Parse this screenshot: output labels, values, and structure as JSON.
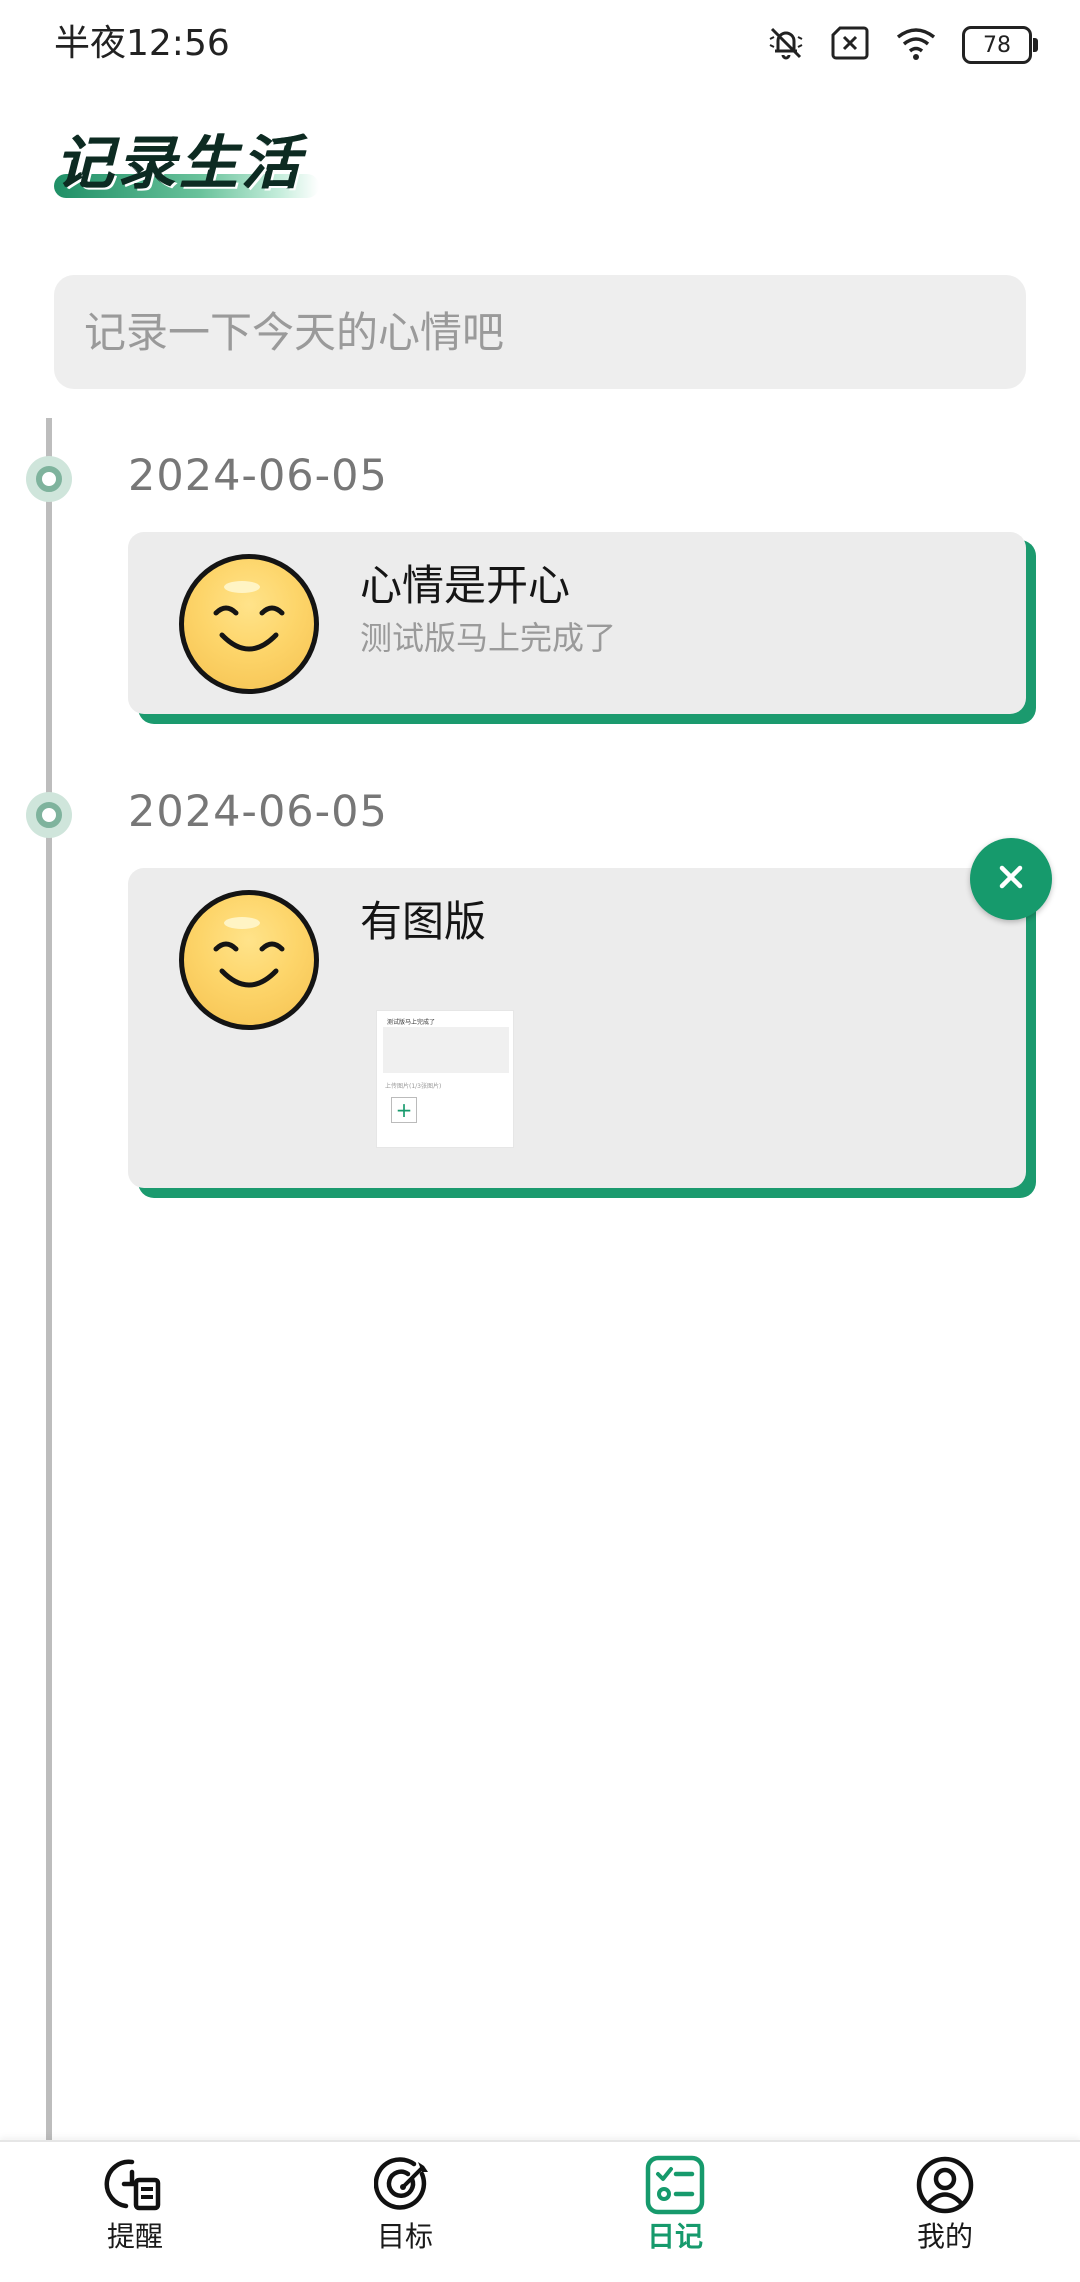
{
  "status_bar": {
    "time": "半夜12:56",
    "battery": "78",
    "icons": [
      "mute-bell-icon",
      "sim-x-icon",
      "wifi-icon",
      "battery-icon"
    ]
  },
  "header": {
    "title": "记录生活"
  },
  "mood_input": {
    "placeholder": "记录一下今天的心情吧",
    "value": ""
  },
  "entries": [
    {
      "date": "2024-06-05",
      "title": "心情是开心",
      "subtitle": "测试版马上完成了",
      "emoji": "smile-face-icon"
    },
    {
      "date": "2024-06-05",
      "title": "有图版",
      "emoji": "smile-face-icon",
      "delete_icon": "close-icon",
      "thumbnail": {
        "line1": "测试版马上完成了",
        "line2": "上传图片(1/3张图片)",
        "button": "+"
      }
    }
  ],
  "bottom_nav": [
    {
      "label": "提醒",
      "icon": "reminder-icon",
      "active": false
    },
    {
      "label": "目标",
      "icon": "target-icon",
      "active": false
    },
    {
      "label": "日记",
      "icon": "diary-icon",
      "active": true
    },
    {
      "label": "我的",
      "icon": "profile-icon",
      "active": false
    }
  ],
  "colors": {
    "accent": "#169a6c",
    "card_bg": "#ececec",
    "input_bg": "#eeeeee",
    "timeline": "#bdbdbd"
  }
}
